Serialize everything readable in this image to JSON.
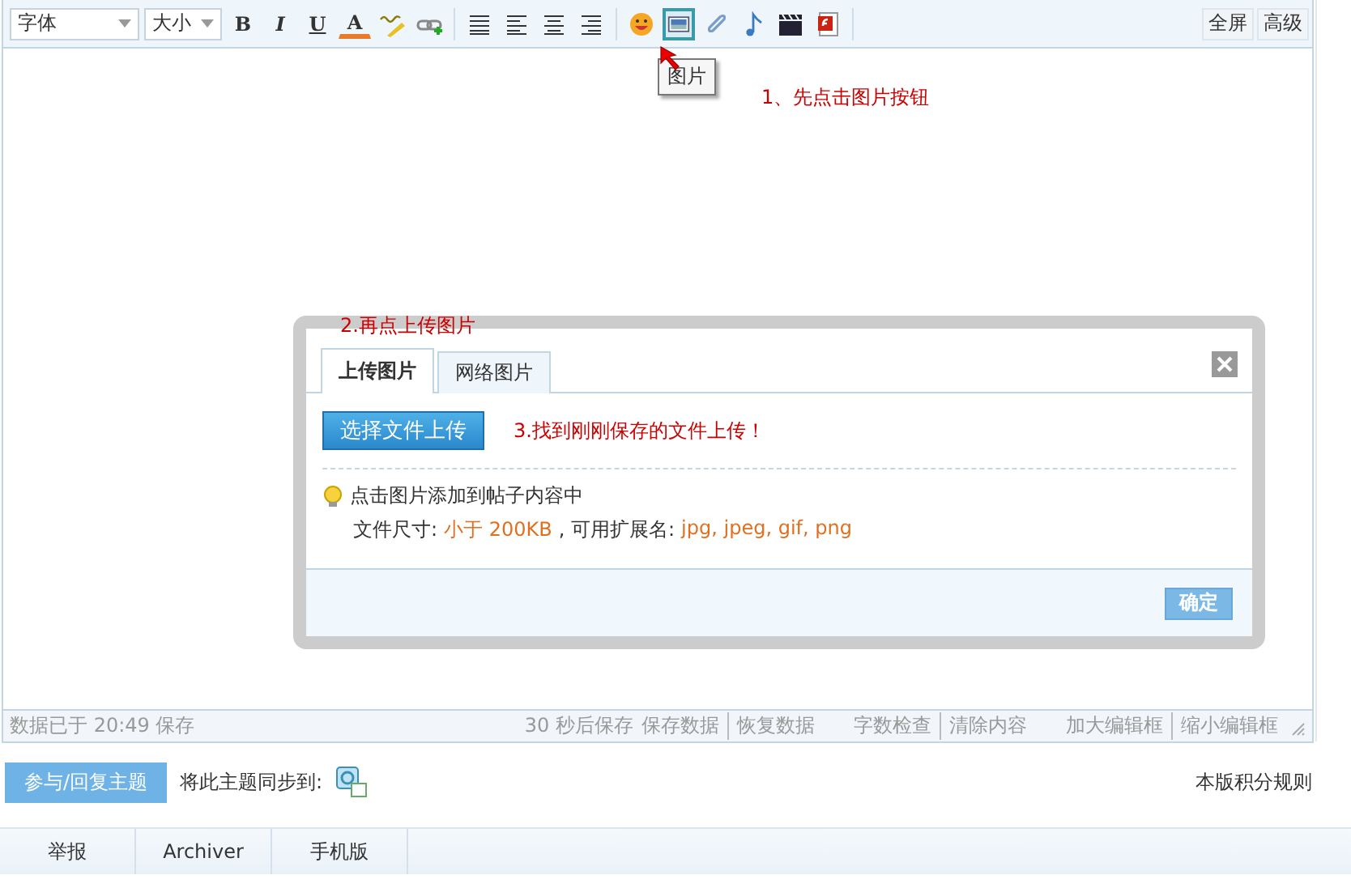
{
  "toolbar": {
    "font_select": "字体",
    "size_select": "大小",
    "format_buttons": [
      {
        "kind": "bold",
        "label": "B"
      },
      {
        "kind": "italic",
        "label": "I"
      },
      {
        "kind": "underline",
        "label": "U"
      },
      {
        "kind": "color",
        "label": "A"
      }
    ],
    "icon_groups": [
      [
        {
          "kind": "spellcheck",
          "highlighted": false
        },
        {
          "kind": "link",
          "highlighted": false
        }
      ],
      [
        {
          "kind": "align-justify",
          "highlighted": false
        },
        {
          "kind": "align-left",
          "highlighted": false
        },
        {
          "kind": "align-center",
          "highlighted": false
        },
        {
          "kind": "align-right",
          "highlighted": false
        }
      ],
      [
        {
          "kind": "smiley",
          "highlighted": false
        },
        {
          "kind": "image",
          "highlighted": true
        },
        {
          "kind": "attachment",
          "highlighted": false
        },
        {
          "kind": "music",
          "highlighted": false
        },
        {
          "kind": "video",
          "highlighted": false
        },
        {
          "kind": "flash",
          "highlighted": false
        }
      ]
    ],
    "right_buttons": [
      "全屏",
      "高级"
    ]
  },
  "tooltip": "图片",
  "annotations": [
    "1、先点击图片按钮",
    "2.再点上传图片",
    "3.找到刚刚保存的文件上传！"
  ],
  "dialog": {
    "tabs": [
      {
        "label": "上传图片",
        "selected": true
      },
      {
        "label": "网络图片",
        "selected": false
      }
    ],
    "upload_button": "选择文件上传",
    "tip": "点击图片添加到帖子内容中",
    "size_label": "文件尺寸:",
    "size_value": "小于 200KB",
    "ext_label": ", 可用扩展名:",
    "ext_value": "jpg, jpeg, gif, png",
    "confirm_button": "确定"
  },
  "status_bar": {
    "saved": "数据已于 20:49 保存",
    "autosave": "30 秒后保存",
    "link_groups": [
      [
        "保存数据",
        "恢复数据"
      ],
      [
        "字数检查",
        "清除内容"
      ],
      [
        "加大编辑框",
        "缩小编辑框"
      ]
    ]
  },
  "reply_button": "参与/回复主题",
  "sync_label": "将此主题同步到:",
  "rules_link": "本版积分规则",
  "footer_links": [
    "举报",
    "Archiver",
    "手机版"
  ]
}
